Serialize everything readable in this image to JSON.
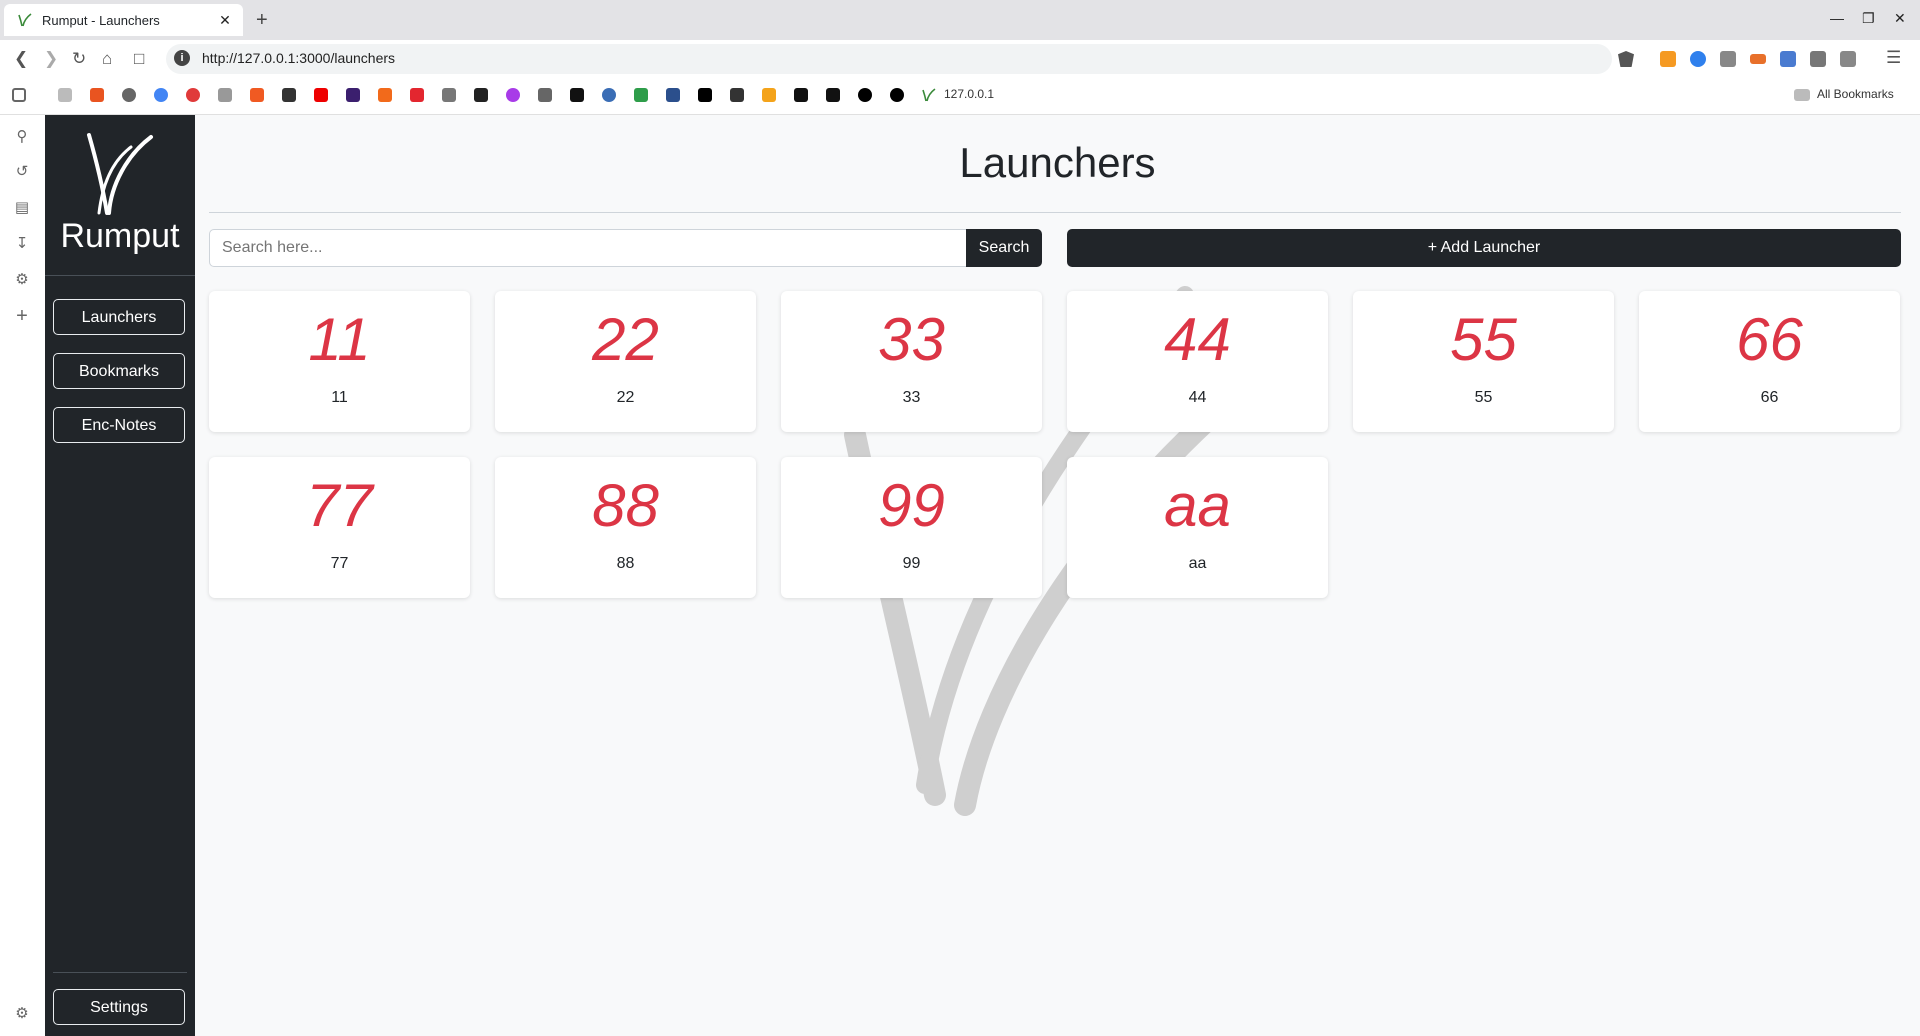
{
  "browser": {
    "tab_title": "Rumput - Launchers",
    "tab_close": "✕",
    "new_tab": "+",
    "url": "http://127.0.0.1:3000/launchers",
    "bookmark_last_label": "127.0.0.1",
    "all_bookmarks": "All Bookmarks",
    "window_controls": [
      "minimize",
      "restore",
      "close"
    ]
  },
  "app": {
    "brand": "Rumput",
    "nav": [
      "Launchers",
      "Bookmarks",
      "Enc-Notes"
    ],
    "settings_label": "Settings",
    "page_title": "Launchers",
    "search": {
      "placeholder": "Search here...",
      "value": "",
      "button": "Search"
    },
    "add_launcher": "+ Add Launcher",
    "launchers": [
      {
        "icon_text": "11",
        "name": "11"
      },
      {
        "icon_text": "22",
        "name": "22"
      },
      {
        "icon_text": "33",
        "name": "33"
      },
      {
        "icon_text": "44",
        "name": "44"
      },
      {
        "icon_text": "55",
        "name": "55"
      },
      {
        "icon_text": "66",
        "name": "66"
      },
      {
        "icon_text": "77",
        "name": "77"
      },
      {
        "icon_text": "88",
        "name": "88"
      },
      {
        "icon_text": "99",
        "name": "99"
      },
      {
        "icon_text": "aa",
        "name": "aa"
      }
    ]
  },
  "colors": {
    "sidebar_bg": "#212529",
    "accent_red": "#dc3545",
    "page_bg": "#f8f9fa"
  }
}
